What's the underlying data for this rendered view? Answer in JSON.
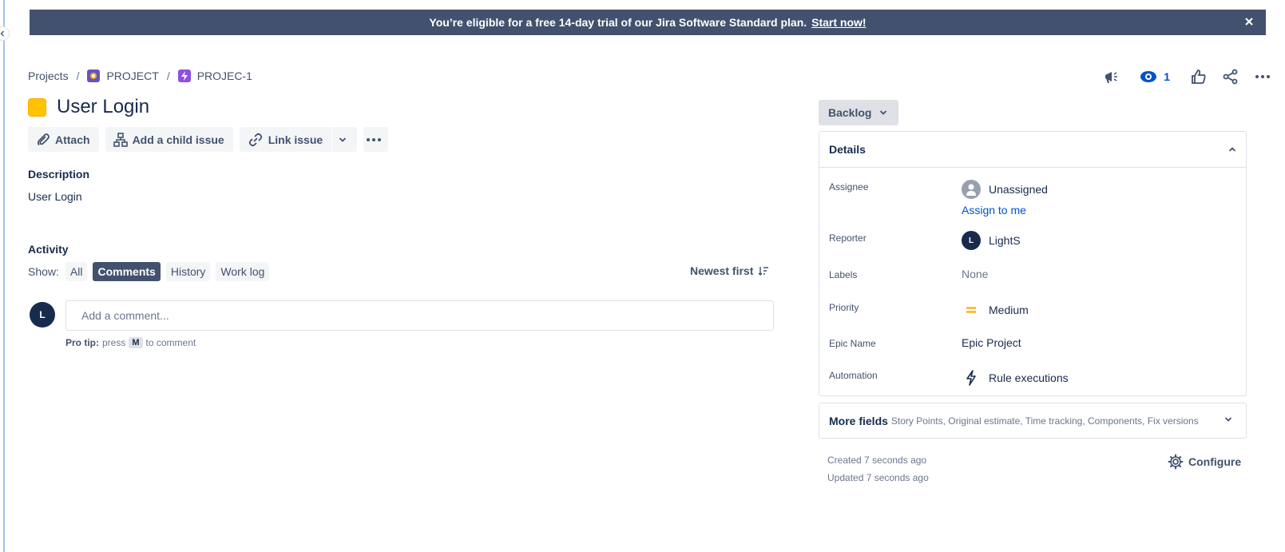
{
  "banner": {
    "message": "You’re eligible for a free 14-day trial of our Jira Software Standard plan.",
    "cta": "Start now!"
  },
  "breadcrumb": {
    "projects": "Projects",
    "separator": "/",
    "project": "PROJECT",
    "issue_key": "PROJEC-1"
  },
  "top_actions": {
    "watch_count": "1"
  },
  "issue": {
    "title": "User Login"
  },
  "toolbar": {
    "attach": "Attach",
    "add_child": "Add a child issue",
    "link_issue": "Link issue"
  },
  "description": {
    "heading": "Description",
    "text": "User Login"
  },
  "activity": {
    "heading": "Activity",
    "show_label": "Show:",
    "filters": [
      "All",
      "Comments",
      "History",
      "Work log"
    ],
    "active_filter": "Comments",
    "sort": "Newest first",
    "avatar_initial": "L",
    "comment_placeholder": "Add a comment...",
    "protip_label": "Pro tip:",
    "protip_press": "press",
    "protip_key": "M",
    "protip_suffix": "to comment"
  },
  "status": {
    "label": "Backlog"
  },
  "details": {
    "heading": "Details",
    "assignee_label": "Assignee",
    "assignee_value": "Unassigned",
    "assign_to_me": "Assign to me",
    "reporter_label": "Reporter",
    "reporter_initial": "L",
    "reporter_value": "LightS",
    "labels_label": "Labels",
    "labels_value": "None",
    "priority_label": "Priority",
    "priority_value": "Medium",
    "epic_name_label": "Epic Name",
    "epic_name_value": "Epic Project",
    "automation_label": "Automation",
    "automation_value": "Rule executions"
  },
  "more_fields": {
    "title": "More fields",
    "list": "Story Points, Original estimate, Time tracking, Components, Fix versions"
  },
  "meta": {
    "created": "Created 7 seconds ago",
    "updated": "Updated 7 seconds ago",
    "configure": "Configure"
  },
  "colors": {
    "banner_bg": "#42526e",
    "epic_color": "#ffc400",
    "link": "#0052cc",
    "priority_medium": "#ffab00",
    "text": "#172b4d"
  }
}
